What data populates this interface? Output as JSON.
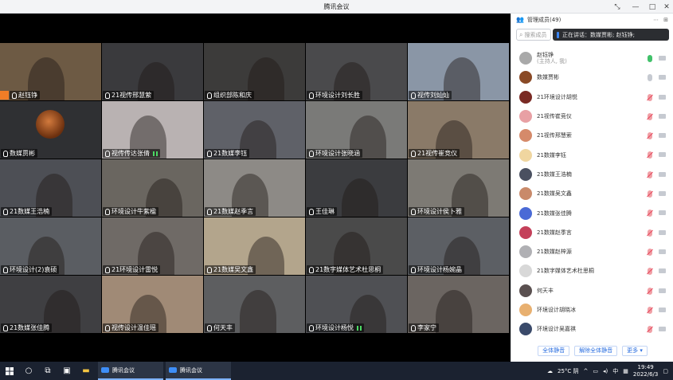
{
  "window": {
    "title": "腾讯会议",
    "controls": {
      "minimize": "—",
      "maximize": "□",
      "close": "✕",
      "pin": "⤡"
    }
  },
  "grid": {
    "tiles": [
      {
        "name": "赵钰铮",
        "host": true,
        "bg": "#6d5a44"
      },
      {
        "name": "21视传邢慧萦",
        "bg": "#3a3a3d"
      },
      {
        "name": "组织部陈和庆",
        "bg": "#3c3b3a"
      },
      {
        "name": "环境设计刘长胜",
        "bg": "#4a4a4c"
      },
      {
        "name": "视传刘灿灿",
        "bg": "#8a96a6"
      },
      {
        "name": "数媒贾彬",
        "avatar": true,
        "bg": "#2f3033"
      },
      {
        "name": "视传传达张倩",
        "signal": true,
        "bg": "#b9b2b2"
      },
      {
        "name": "21数媒李钰",
        "bg": "#5f6168"
      },
      {
        "name": "环境设计张晓涵",
        "bg": "#7a7a78"
      },
      {
        "name": "21视传崔竞仪",
        "bg": "#8a7a68"
      },
      {
        "name": "21数媒王浩楠",
        "bg": "#4d4f55"
      },
      {
        "name": "环境设计牛紫楹",
        "bg": "#6a6660"
      },
      {
        "name": "21数媒赵季言",
        "bg": "#8d8a86"
      },
      {
        "name": "王佳琳",
        "bg": "#3b3c3f"
      },
      {
        "name": "环境设计侯卜雅",
        "bg": "#7d7a74"
      },
      {
        "name": "环境设计(2)袁硕",
        "bg": "#5a5d62"
      },
      {
        "name": "21环境设计雷悦",
        "bg": "#6f6a66"
      },
      {
        "name": "21数媒吴文鑫",
        "bg": "#b3a58c"
      },
      {
        "name": "21数字媒体艺术杜思桐",
        "bg": "#4a4a4a"
      },
      {
        "name": "环境设计杨婉晶",
        "bg": "#5c5f64"
      },
      {
        "name": "21数媒张佳腾",
        "bg": "#3f3f42"
      },
      {
        "name": "视传设计温佳瑶",
        "bg": "#a08a76"
      },
      {
        "name": "何天丰",
        "bg": "#5d5e60"
      },
      {
        "name": "环境设计杨悦",
        "signal": true,
        "bg": "#4f5054"
      },
      {
        "name": "李家宁",
        "bg": "#6b6561"
      }
    ]
  },
  "panel": {
    "title": "管理成员(49)",
    "header_icons": [
      "more-icon",
      "expand-icon"
    ],
    "search_placeholder": "搜索成员",
    "speaking_label": "正在讲话：数媒贾彬; 赵钰铮;",
    "members": [
      {
        "name": "赵钰铮",
        "sub": "(主持人, 我)",
        "mic": "on",
        "avatar": "#a9a9a9"
      },
      {
        "name": "数媒贾彬",
        "mic": "grey",
        "avatar": "#8a4a26"
      },
      {
        "name": "21环境设计胡悦",
        "mic": "off",
        "avatar": "#7a2a24"
      },
      {
        "name": "21视传崔竞仪",
        "mic": "off",
        "avatar": "#e8a0a4"
      },
      {
        "name": "21视传邢慧萦",
        "mic": "off",
        "avatar": "#d58a6a"
      },
      {
        "name": "21数媒李钰",
        "mic": "off",
        "avatar": "#f0d6a0"
      },
      {
        "name": "21数媒王浩楠",
        "mic": "off",
        "avatar": "#4a5060"
      },
      {
        "name": "21数媒吴文鑫",
        "mic": "off",
        "avatar": "#c98a6a"
      },
      {
        "name": "21数媒张佳腾",
        "mic": "off",
        "avatar": "#4a6ad6"
      },
      {
        "name": "21数媒赵季言",
        "mic": "off",
        "avatar": "#c4405a"
      },
      {
        "name": "21数媒赵梓源",
        "mic": "off",
        "avatar": "#b0b0b4"
      },
      {
        "name": "21数字媒体艺术杜思桐",
        "mic": "off",
        "avatar": "#d8d8d8"
      },
      {
        "name": "何天丰",
        "mic": "off",
        "avatar": "#5a5050"
      },
      {
        "name": "环境设计胡晓冰",
        "mic": "off",
        "avatar": "#e8b070"
      },
      {
        "name": "环境设计吴嘉祺",
        "mic": "off",
        "avatar": "#3a4a6a"
      }
    ],
    "footer": {
      "mute_all": "全体静音",
      "unmute_all": "解除全体静音",
      "more": "更多 ▾"
    }
  },
  "taskbar": {
    "apps": [
      {
        "label": "腾讯会议"
      },
      {
        "label": "腾讯会议"
      }
    ],
    "weather": "25°C 阴",
    "ime": "中",
    "time": "19:49",
    "date": "2022/6/3"
  }
}
